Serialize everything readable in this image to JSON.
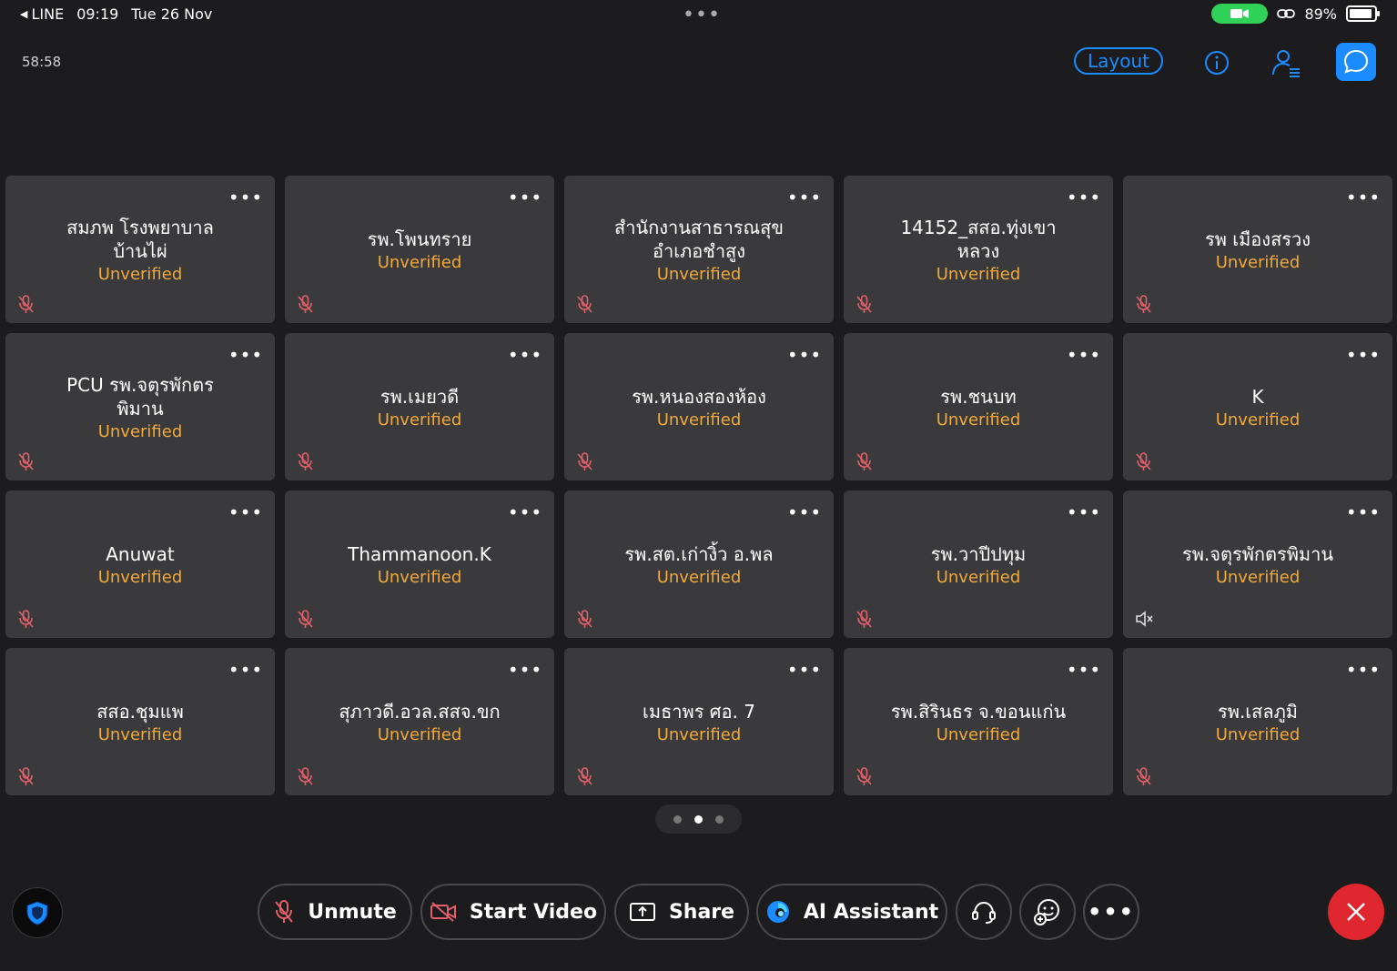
{
  "status_bar": {
    "back_app": "LINE",
    "time": "09:19",
    "date": "Tue 26 Nov",
    "battery": "89%"
  },
  "meeting": {
    "timer": "58:58",
    "layout_label": "Layout"
  },
  "participants": [
    {
      "name": "สมภพ โรงพยาบาลบ้านไผ่",
      "status": "Unverified",
      "audio": "muted"
    },
    {
      "name": "รพ.โพนทราย",
      "status": "Unverified",
      "audio": "muted"
    },
    {
      "name": "สำนักงานสาธารณสุขอำเภอชำสูง",
      "status": "Unverified",
      "audio": "muted"
    },
    {
      "name": "14152_สสอ.ทุ่งเขาหลวง",
      "status": "Unverified",
      "audio": "muted"
    },
    {
      "name": "รพ เมืองสรวง",
      "status": "Unverified",
      "audio": "muted"
    },
    {
      "name": "PCU รพ.จตุรพักตรพิมาน",
      "status": "Unverified",
      "audio": "muted"
    },
    {
      "name": "รพ.เมยวดี",
      "status": "Unverified",
      "audio": "muted"
    },
    {
      "name": "รพ.หนองสองห้อง",
      "status": "Unverified",
      "audio": "muted"
    },
    {
      "name": "รพ.ชนบท",
      "status": "Unverified",
      "audio": "muted"
    },
    {
      "name": "K",
      "status": "Unverified",
      "audio": "muted"
    },
    {
      "name": "Anuwat",
      "status": "Unverified",
      "audio": "muted"
    },
    {
      "name": "Thammanoon.K",
      "status": "Unverified",
      "audio": "muted"
    },
    {
      "name": "รพ.สต.เก่างิ้ว อ.พล",
      "status": "Unverified",
      "audio": "muted"
    },
    {
      "name": "รพ.วาปีปทุม",
      "status": "Unverified",
      "audio": "muted"
    },
    {
      "name": "รพ.จตุรพักตรพิมาน",
      "status": "Unverified",
      "audio": "speaker-off"
    },
    {
      "name": "สสอ.ชุมแพ",
      "status": "Unverified",
      "audio": "muted"
    },
    {
      "name": "สุภาวดี.อวล.สสจ.ขก",
      "status": "Unverified",
      "audio": "muted"
    },
    {
      "name": "เมธาพร ศอ. 7",
      "status": "Unverified",
      "audio": "muted"
    },
    {
      "name": "รพ.สิรินธร จ.ขอนแก่น",
      "status": "Unverified",
      "audio": "muted"
    },
    {
      "name": "รพ.เสลภูมิ",
      "status": "Unverified",
      "audio": "muted"
    }
  ],
  "pager": {
    "pages": 3,
    "current": 2
  },
  "controls": {
    "unmute_label": "Unmute",
    "start_video_label": "Start Video",
    "share_label": "Share",
    "ai_label": "AI Assistant"
  },
  "colors": {
    "accent": "#1a8cff",
    "unverified": "#f0a93a",
    "muted_icon": "#e3606a",
    "end_call": "#e0262e",
    "tile_bg": "#3a3a3c",
    "background": "#1c1c1e"
  }
}
